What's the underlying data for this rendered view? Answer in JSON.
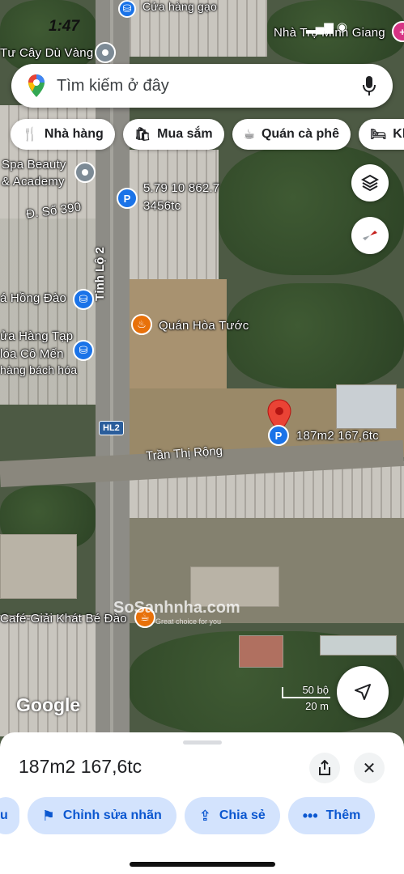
{
  "status_bar": {
    "time": "1:47",
    "signal": "▂▄▆ ◉"
  },
  "search": {
    "placeholder": "Tìm kiếm ở đây"
  },
  "chips": [
    {
      "icon": "restaurant-icon",
      "label": "Nhà hàng"
    },
    {
      "icon": "shopping-bag-icon",
      "label": "Mua sắm"
    },
    {
      "icon": "coffee-icon",
      "label": "Quán cà phê"
    },
    {
      "icon": "bed-icon",
      "label": "Kh"
    }
  ],
  "map": {
    "labels": {
      "top_store": "Cửa hàng gạo",
      "cay_du_vang": "Tư Cây Dù Vàng",
      "nha_tro": "Nhà Trọ Minh Giang",
      "spa_1": "Spa Beauty",
      "spa_2": "& Academy",
      "duong_390": "Đ. Số 390",
      "pin_parking_1": "5.79 10  862.7",
      "pin_parking_2": "3456tc",
      "tinh_lo": "Tỉnh Lộ 2",
      "hong_dao": "á Hồng Đào",
      "quan_hoa_tuoc": "Quán Hòa Tước",
      "tap_hoa_1": "ửa Hàng Tạp",
      "tap_hoa_2": "lóa Cô Mến",
      "tap_hoa_3": "hàng bách hóa",
      "hl2": "HL2",
      "tran_thi_rong": "Trần Thị Rộng",
      "selected_place": "187m2 167,6tc",
      "cafe": "Café-Giải Khát Bé Đào"
    },
    "watermark": "SoSanhnha.com",
    "watermark_sub": "Great choice for you",
    "logo": "Google",
    "scale": {
      "feet": "50 bộ",
      "meters": "20 m"
    }
  },
  "sheet": {
    "title": "187m2 167,6tc",
    "actions": [
      {
        "icon": "partial-icon",
        "label": "u"
      },
      {
        "icon": "flag-icon",
        "label": "Chỉnh sửa nhãn"
      },
      {
        "icon": "share-icon",
        "label": "Chia sẻ"
      },
      {
        "icon": "more-icon",
        "label": "Thêm"
      }
    ]
  },
  "colors": {
    "accent": "#1a73e8",
    "action_bg": "#d3e3fd",
    "action_text": "#0b57d0",
    "marker": "#ea4335"
  }
}
